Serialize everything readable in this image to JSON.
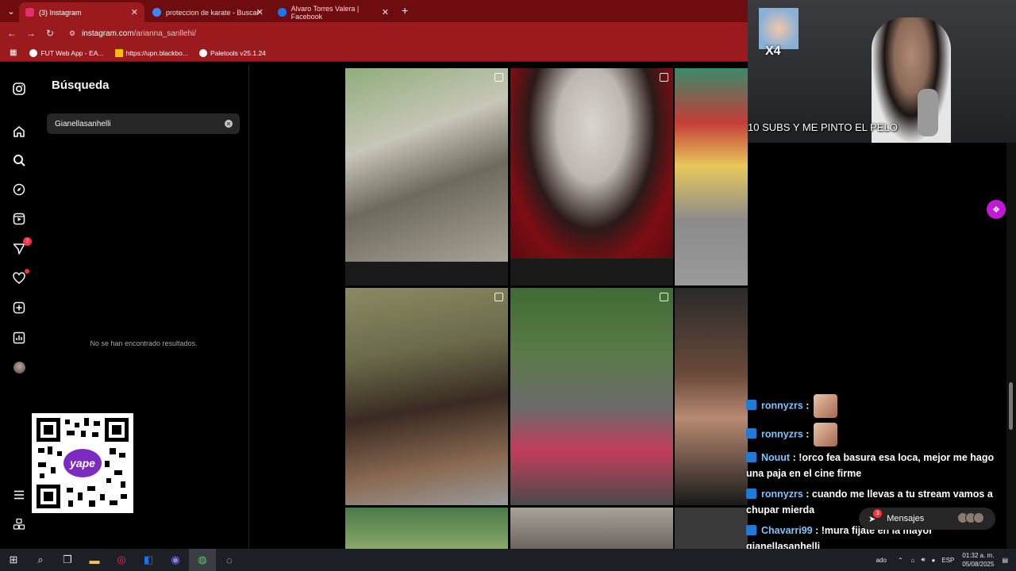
{
  "browser": {
    "tabs": [
      {
        "label": "(3) Instagram",
        "active": true,
        "favicon_color": "#e1306c"
      },
      {
        "label": "proteccion de karate - Buscar c",
        "active": false,
        "favicon_color": "#4285f4"
      },
      {
        "label": "Alvaro Torres Valera | Facebook",
        "active": false,
        "favicon_color": "#1877f2"
      }
    ],
    "new_tab_label": "+",
    "url_host": "instagram.com",
    "url_path": "/arianna_sanllehi/",
    "bookmarks": [
      {
        "label": "FUT Web App - EA...",
        "icon_color": "#ffffff"
      },
      {
        "label": "https://upn.blackbo...",
        "icon_color": "#f2c200"
      },
      {
        "label": "Paletools v25.1.24",
        "icon_color": "#ffffff"
      }
    ]
  },
  "nav": {
    "notifications_badge": "3"
  },
  "search": {
    "title": "Búsqueda",
    "value": "Gianellasanhelli",
    "no_results": "No se han encontrado resultados."
  },
  "stream": {
    "caption": "10 SUBS Y ME PINTO EL PELO",
    "multiplier": "X4",
    "chat": [
      {
        "user": "ronnyzrs",
        "text": " :",
        "emote": true
      },
      {
        "user": "ronnyzrs",
        "text": " :",
        "emote": true
      },
      {
        "user": "Nouut",
        "text": " : !orco fea basura esa loca, mejor me hago una paja en el cine firme",
        "emote": false
      },
      {
        "user": "ronnyzrs",
        "text": " : cuando me llevas a tu stream vamos a chupar mierda",
        "emote": false
      },
      {
        "user": "Chavarri99",
        "text": " : !mura fijate en la mayor gianellasanhelli",
        "emote": false
      }
    ]
  },
  "messages_pill": {
    "label": "Mensajes",
    "badge": "3"
  },
  "taskbar": {
    "lang": "ESP",
    "time": "01:32 a. m.",
    "date": "05/08/2025",
    "tray_fragment": "ado"
  },
  "colors": {
    "chrome_dark": "#6e0c10",
    "chrome": "#9b1a1e",
    "ig_bg": "#000000",
    "chat_user": "#7ec4ff",
    "ext_accent": "#c01ad6"
  }
}
